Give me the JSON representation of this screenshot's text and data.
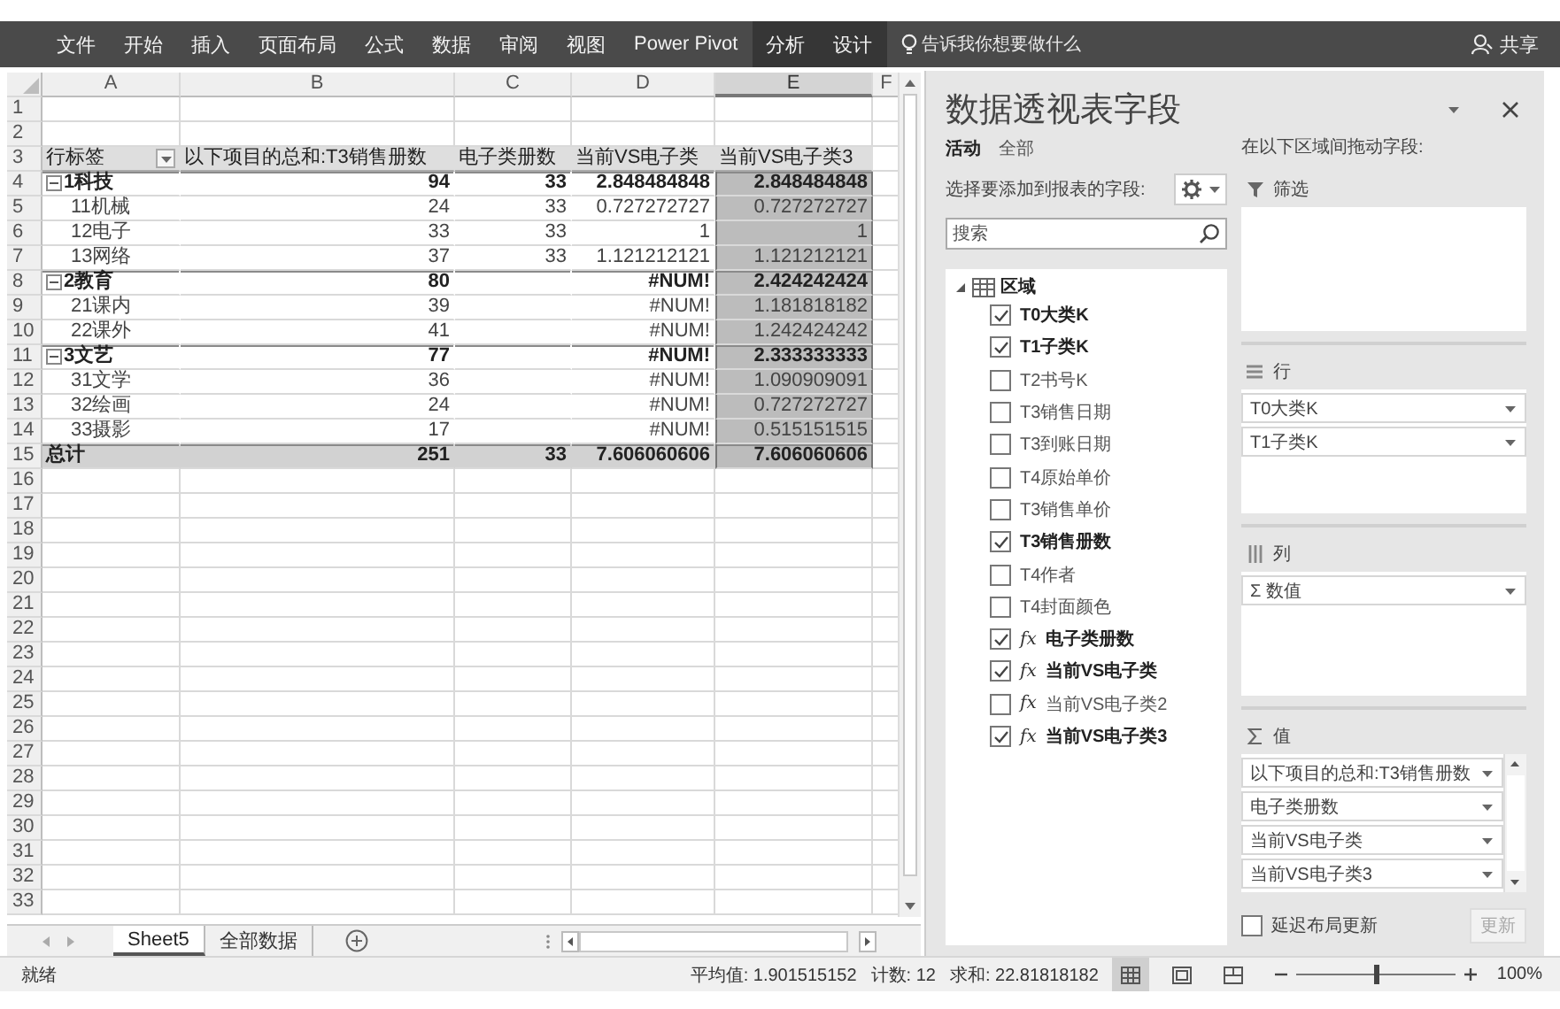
{
  "ribbon": {
    "tabs": [
      {
        "label": "文件",
        "contextual": false
      },
      {
        "label": "开始",
        "contextual": false
      },
      {
        "label": "插入",
        "contextual": false
      },
      {
        "label": "页面布局",
        "contextual": false
      },
      {
        "label": "公式",
        "contextual": false
      },
      {
        "label": "数据",
        "contextual": false
      },
      {
        "label": "审阅",
        "contextual": false
      },
      {
        "label": "视图",
        "contextual": false
      },
      {
        "label": "Power Pivot",
        "contextual": false
      },
      {
        "label": "分析",
        "contextual": true
      },
      {
        "label": "设计",
        "contextual": true
      }
    ],
    "tell_me": "告诉我你想要做什么",
    "share": "共享"
  },
  "sheet": {
    "columns": [
      {
        "label": "A",
        "selected": false
      },
      {
        "label": "B",
        "selected": false
      },
      {
        "label": "C",
        "selected": false
      },
      {
        "label": "D",
        "selected": false
      },
      {
        "label": "E",
        "selected": true
      },
      {
        "label": "F",
        "selected": false
      }
    ],
    "rows": [
      {
        "number": "1"
      },
      {
        "number": "2"
      },
      {
        "number": "3",
        "kind": "header",
        "cells": [
          "行标签",
          "以下项目的总和:T3销售册数",
          "电子类册数",
          "当前VS电子类",
          "当前VS电子类3"
        ]
      },
      {
        "number": "4",
        "kind": "group",
        "expanded": true,
        "cells": [
          "1科技",
          "94",
          "33",
          "2.848484848",
          "2.848484848"
        ]
      },
      {
        "number": "5",
        "kind": "item",
        "cells": [
          "11机械",
          "24",
          "33",
          "0.727272727",
          "0.727272727"
        ]
      },
      {
        "number": "6",
        "kind": "item",
        "cells": [
          "12电子",
          "33",
          "33",
          "1",
          "1"
        ]
      },
      {
        "number": "7",
        "kind": "item",
        "cells": [
          "13网络",
          "37",
          "33",
          "1.121212121",
          "1.121212121"
        ]
      },
      {
        "number": "8",
        "kind": "group",
        "expanded": true,
        "cells": [
          "2教育",
          "80",
          null,
          "#NUM!",
          "2.424242424"
        ]
      },
      {
        "number": "9",
        "kind": "item",
        "cells": [
          "21课内",
          "39",
          null,
          "#NUM!",
          "1.181818182"
        ]
      },
      {
        "number": "10",
        "kind": "item",
        "cells": [
          "22课外",
          "41",
          null,
          "#NUM!",
          "1.242424242"
        ]
      },
      {
        "number": "11",
        "kind": "group",
        "expanded": true,
        "cells": [
          "3文艺",
          "77",
          null,
          "#NUM!",
          "2.333333333"
        ]
      },
      {
        "number": "12",
        "kind": "item",
        "cells": [
          "31文学",
          "36",
          null,
          "#NUM!",
          "1.090909091"
        ]
      },
      {
        "number": "13",
        "kind": "item",
        "cells": [
          "32绘画",
          "24",
          null,
          "#NUM!",
          "0.727272727"
        ]
      },
      {
        "number": "14",
        "kind": "item",
        "cells": [
          "33摄影",
          "17",
          null,
          "#NUM!",
          "0.515151515"
        ]
      },
      {
        "number": "15",
        "kind": "total",
        "cells": [
          "总计",
          "251",
          "33",
          "7.606060606",
          "7.606060606"
        ]
      },
      {
        "number": "16"
      },
      {
        "number": "17"
      },
      {
        "number": "18"
      },
      {
        "number": "19"
      },
      {
        "number": "20"
      },
      {
        "number": "21"
      },
      {
        "number": "22"
      },
      {
        "number": "23"
      },
      {
        "number": "24"
      },
      {
        "number": "25"
      },
      {
        "number": "26"
      },
      {
        "number": "27"
      },
      {
        "number": "28"
      },
      {
        "number": "29"
      },
      {
        "number": "30"
      },
      {
        "number": "31"
      },
      {
        "number": "32"
      },
      {
        "number": "33"
      }
    ]
  },
  "sheet_tabs": [
    {
      "label": "Sheet5",
      "selected": true
    },
    {
      "label": "全部数据",
      "selected": false
    }
  ],
  "status_bar": {
    "ready": "就绪",
    "average": "平均值: 1.901515152",
    "count": "计数: 12",
    "sum": "求和: 22.81818182",
    "views": [
      {
        "kind": "normal",
        "selected": true
      },
      {
        "kind": "page_layout",
        "selected": false
      },
      {
        "kind": "page_break",
        "selected": false
      }
    ],
    "zoom": {
      "level": 0.5,
      "label": "100%"
    }
  },
  "pivot_panel": {
    "title": "数据透视表字段",
    "tabs": [
      {
        "label": "活动",
        "selected": true
      },
      {
        "label": "全部",
        "selected": false
      }
    ],
    "choose_label": "选择要添加到报表的字段:",
    "search": {
      "placeholder": "搜索"
    },
    "field_tree": [
      {
        "label": "区域",
        "expanded": true,
        "children": [
          {
            "label": "T0大类K",
            "checked": true
          },
          {
            "label": "T1子类K",
            "checked": true
          },
          {
            "label": "T2书号K",
            "checked": false
          },
          {
            "label": "T3销售日期",
            "checked": false
          },
          {
            "label": "T3到账日期",
            "checked": false
          },
          {
            "label": "T4原始单价",
            "checked": false
          },
          {
            "label": "T3销售单价",
            "checked": false
          },
          {
            "label": "T3销售册数",
            "checked": true
          },
          {
            "label": "T4作者",
            "checked": false
          },
          {
            "label": "T4封面颜色",
            "checked": false
          },
          {
            "label": "电子类册数",
            "checked": true,
            "prefix": "fx"
          },
          {
            "label": "当前VS电子类",
            "checked": true,
            "prefix": "fx"
          },
          {
            "label": "当前VS电子类2",
            "checked": false,
            "prefix": "fx"
          },
          {
            "label": "当前VS电子类3",
            "checked": true,
            "prefix": "fx"
          }
        ]
      }
    ],
    "drag_label": "在以下区域间拖动字段:",
    "areas": [
      {
        "kind": "filter",
        "label": "筛选"
      },
      {
        "kind": "rows",
        "label": "行",
        "items": [
          "T0大类K",
          "T1子类K"
        ]
      },
      {
        "kind": "columns",
        "label": "列",
        "items": [
          "Σ 数值"
        ]
      },
      {
        "kind": "values",
        "label": "值",
        "items": [
          "以下项目的总和:T3销售册数",
          "电子类册数",
          "当前VS电子类",
          "当前VS电子类3"
        ]
      }
    ],
    "defer_update": {
      "label": "延迟布局更新",
      "checked": false
    },
    "update_button": {
      "label": "更新",
      "disabled": true
    }
  }
}
